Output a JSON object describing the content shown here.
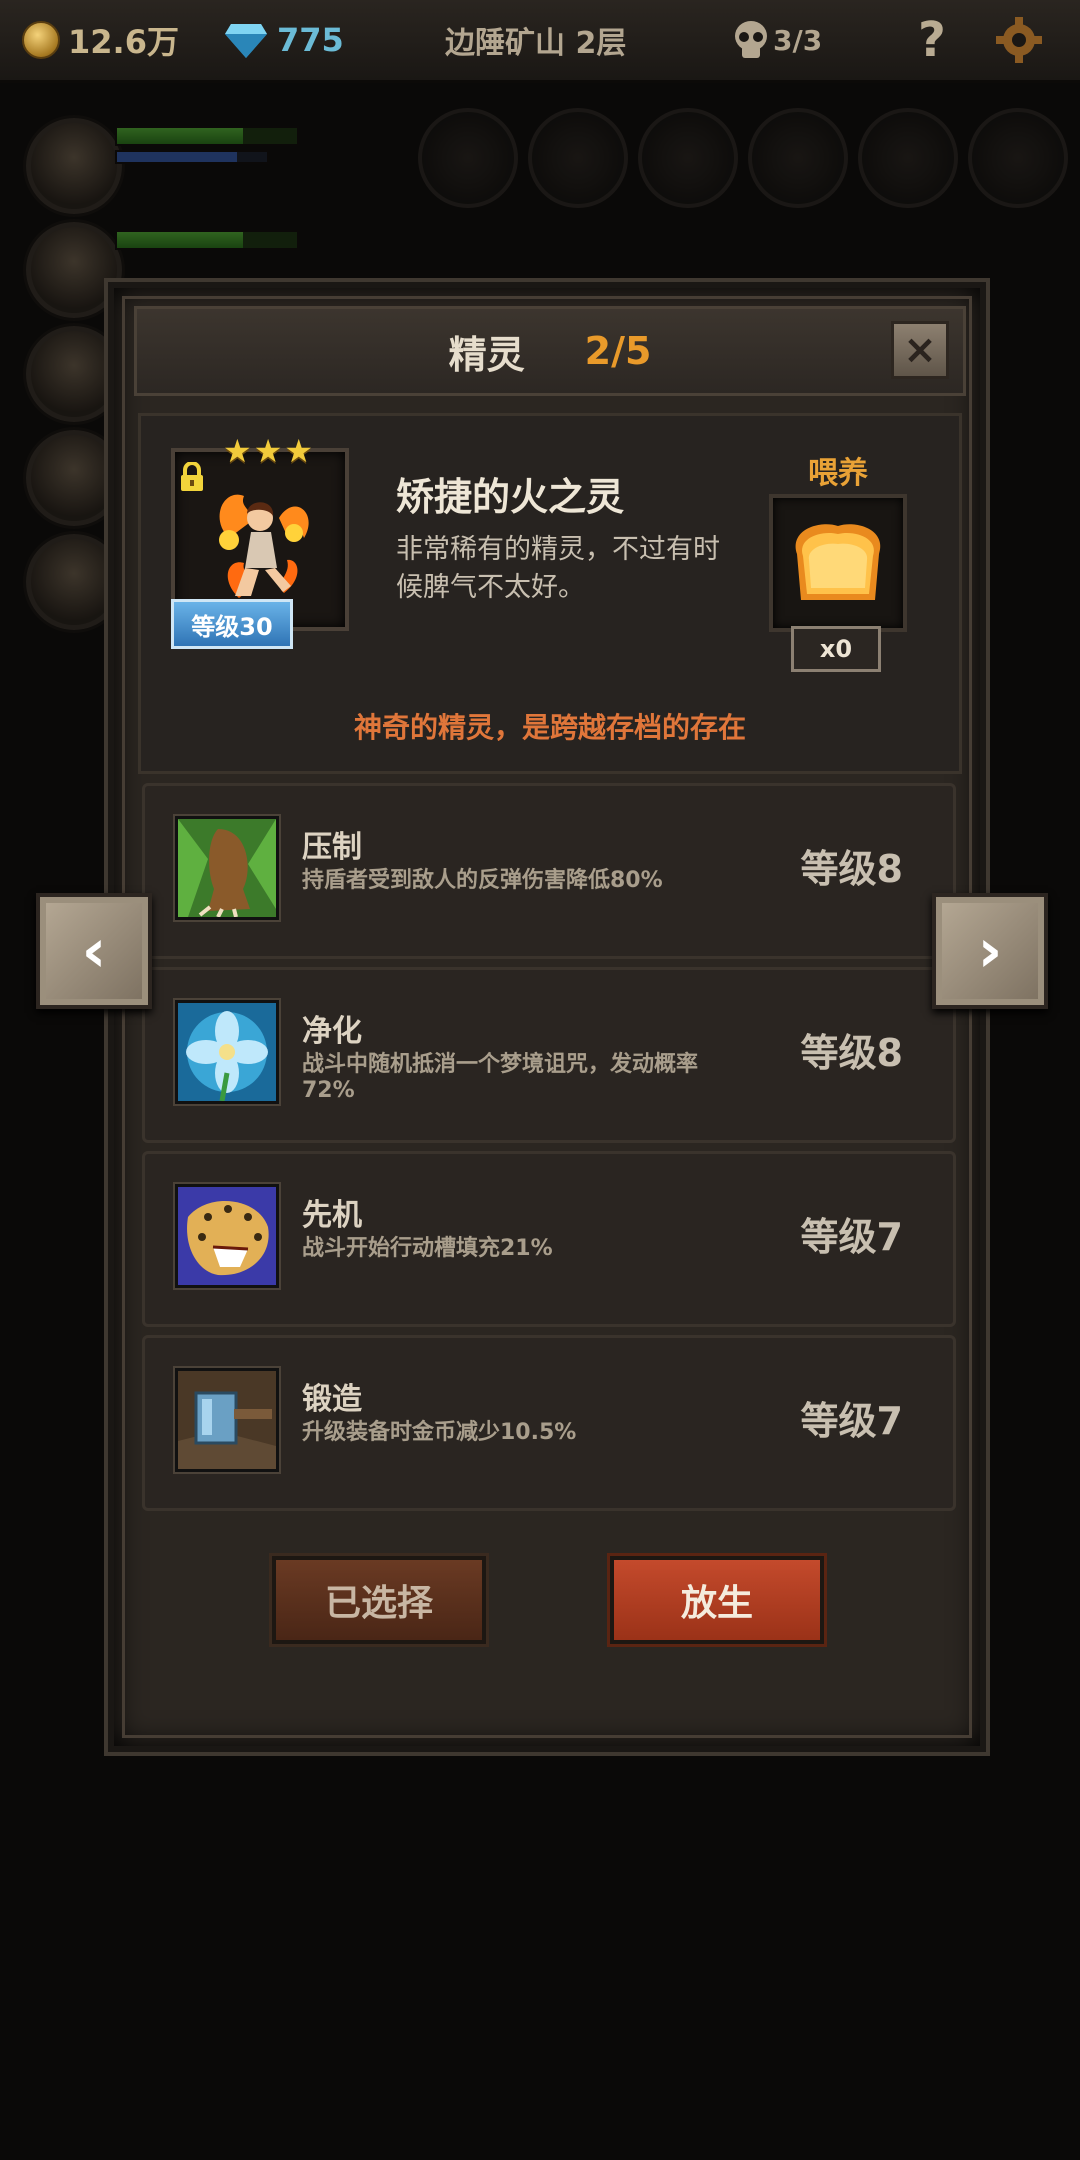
{
  "topbar": {
    "gold": "12.6万",
    "gems": "775",
    "location": "边陲矿山 2层",
    "party": "3/3",
    "help": "?"
  },
  "modal": {
    "title": "精灵",
    "count": "2/5",
    "close": "×"
  },
  "spirit": {
    "stars": "★★★",
    "level": "等级30",
    "name": "矫捷的火之灵",
    "description": "非常稀有的精灵，不过有时候脾气不太好。",
    "feed_label": "喂养",
    "feed_count": "x0",
    "notice": "神奇的精灵，是跨越存档的存在"
  },
  "skills": [
    {
      "name": "压制",
      "desc": "持盾者受到敌人的反弹伤害降低80%",
      "level": "等级8",
      "icon": "beast-claw-icon"
    },
    {
      "name": "净化",
      "desc": "战斗中随机抵消一个梦境诅咒，发动概率72%",
      "level": "等级8",
      "icon": "blue-flower-icon"
    },
    {
      "name": "先机",
      "desc": "战斗开始行动槽填充21%",
      "level": "等级7",
      "icon": "leopard-icon"
    },
    {
      "name": "锻造",
      "desc": "升级装备时金币减少10.5%",
      "level": "等级7",
      "icon": "forge-hammer-icon"
    }
  ],
  "buttons": {
    "selected": "已选择",
    "release": "放生"
  },
  "nav": {
    "prev": "‹",
    "next": "›"
  },
  "colors": {
    "accent_orange": "#e99a2a",
    "notice_red": "#e0763a",
    "level_badge_blue": "#2f74b5",
    "release_red": "#c44a2c"
  }
}
